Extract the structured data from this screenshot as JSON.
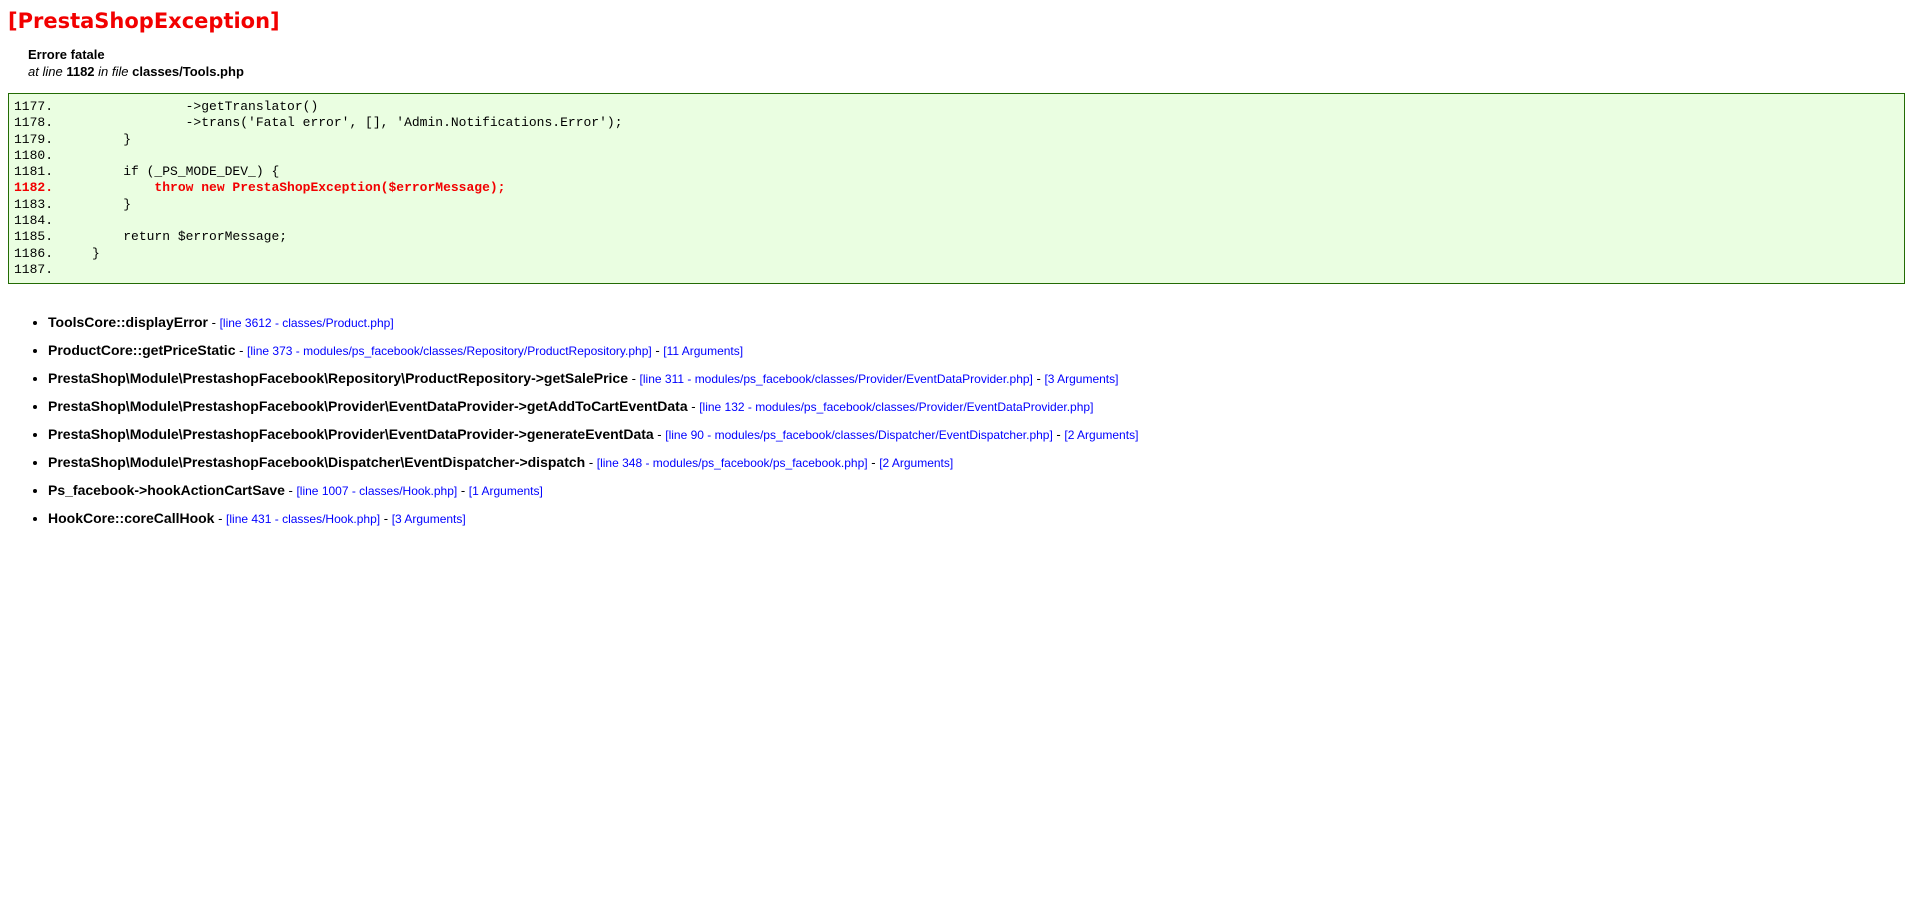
{
  "page": {
    "title": "[PrestaShopException]",
    "message": "Errore fatale",
    "location": {
      "at_line_label": "at line",
      "line_number": "1182",
      "in_file_label": "in file",
      "file_path": "classes/Tools.php"
    }
  },
  "colors": {
    "accent_red": "#F20000",
    "link_blue": "#0000FF",
    "code_background": "#EAFEE1",
    "code_border_green": "#236B04"
  },
  "code_excerpt": {
    "highlighted_line_number": "1182",
    "lines": [
      {
        "number": "1177.",
        "code": "                ->getTranslator()",
        "selected": false
      },
      {
        "number": "1178.",
        "code": "                ->trans('Fatal error', [], 'Admin.Notifications.Error');",
        "selected": false
      },
      {
        "number": "1179.",
        "code": "        }",
        "selected": false
      },
      {
        "number": "1180.",
        "code": "",
        "selected": false
      },
      {
        "number": "1181.",
        "code": "        if (_PS_MODE_DEV_) {",
        "selected": false
      },
      {
        "number": "1182.",
        "code": "            throw new PrestaShopException($errorMessage);",
        "selected": true
      },
      {
        "number": "1183.",
        "code": "        }",
        "selected": false
      },
      {
        "number": "1184.",
        "code": "",
        "selected": false
      },
      {
        "number": "1185.",
        "code": "        return $errorMessage;",
        "selected": false
      },
      {
        "number": "1186.",
        "code": "    }",
        "selected": false
      },
      {
        "number": "1187.",
        "code": "",
        "selected": false
      }
    ]
  },
  "stack_trace": {
    "separator": "-",
    "items": [
      {
        "function": "ToolsCore::displayError",
        "file_link": "[line 3612 - classes/Product.php]",
        "args_link": null
      },
      {
        "function": "ProductCore::getPriceStatic",
        "file_link": "[line 373 - modules/ps_facebook/classes/Repository/ProductRepository.php]",
        "args_link": "[11 Arguments]"
      },
      {
        "function": "PrestaShop\\Module\\PrestashopFacebook\\Repository\\ProductRepository->getSalePrice",
        "file_link": "[line 311 - modules/ps_facebook/classes/Provider/EventDataProvider.php]",
        "args_link": "[3 Arguments]"
      },
      {
        "function": "PrestaShop\\Module\\PrestashopFacebook\\Provider\\EventDataProvider->getAddToCartEventData",
        "file_link": "[line 132 - modules/ps_facebook/classes/Provider/EventDataProvider.php]",
        "args_link": null
      },
      {
        "function": "PrestaShop\\Module\\PrestashopFacebook\\Provider\\EventDataProvider->generateEventData",
        "file_link": "[line 90 - modules/ps_facebook/classes/Dispatcher/EventDispatcher.php]",
        "args_link": "[2 Arguments]"
      },
      {
        "function": "PrestaShop\\Module\\PrestashopFacebook\\Dispatcher\\EventDispatcher->dispatch",
        "file_link": "[line 348 - modules/ps_facebook/ps_facebook.php]",
        "args_link": "[2 Arguments]"
      },
      {
        "function": "Ps_facebook->hookActionCartSave",
        "file_link": "[line 1007 - classes/Hook.php]",
        "args_link": "[1 Arguments]"
      },
      {
        "function": "HookCore::coreCallHook",
        "file_link": "[line 431 - classes/Hook.php]",
        "args_link": "[3 Arguments]"
      }
    ]
  }
}
